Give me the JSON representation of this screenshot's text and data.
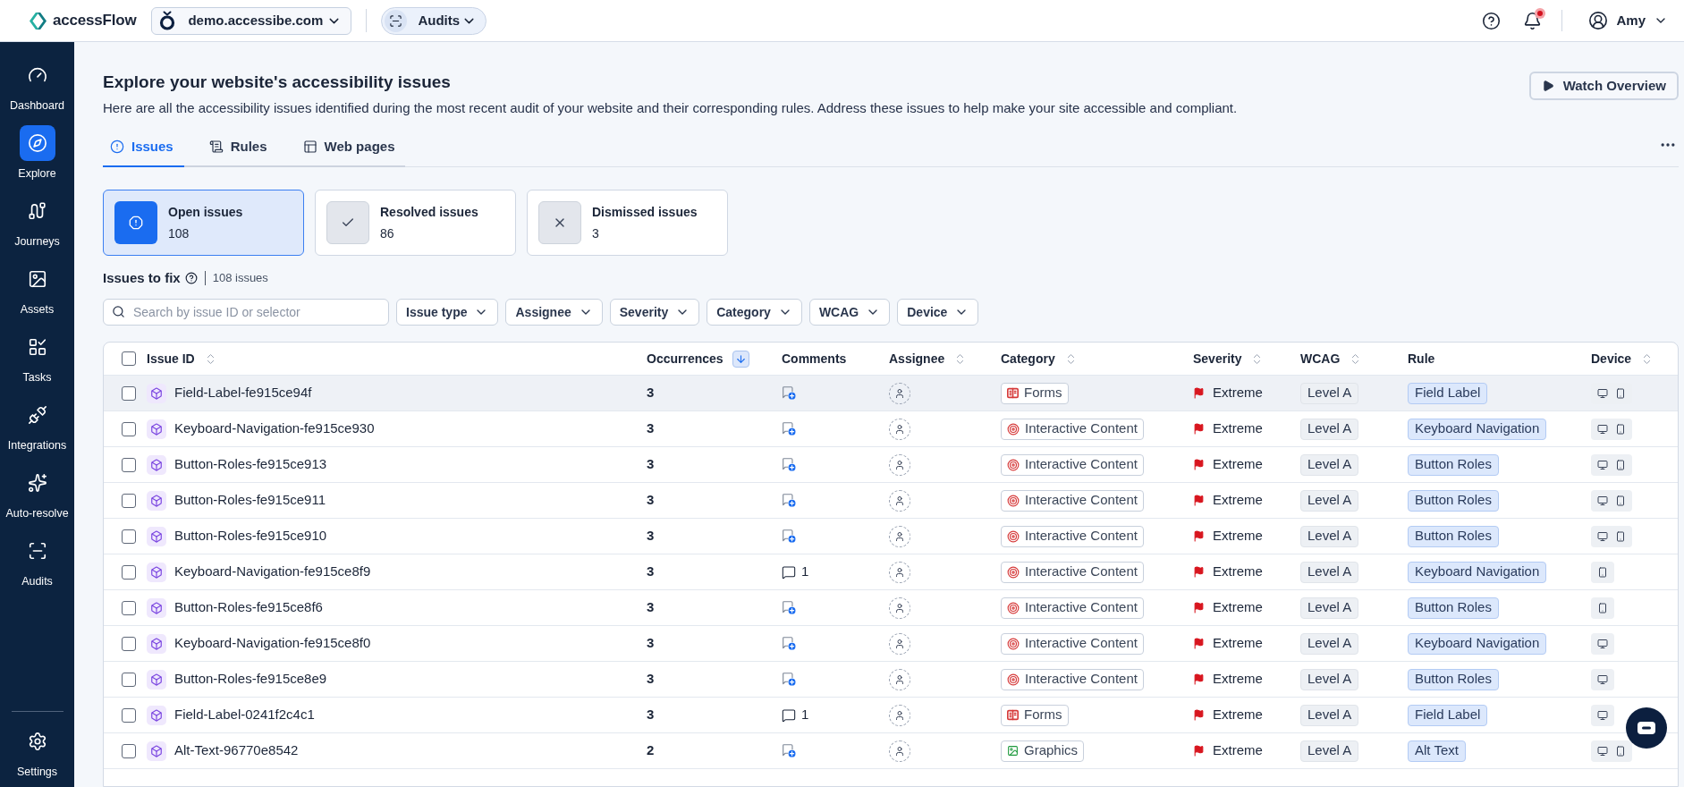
{
  "top_bar": {
    "brand": "accessFlow",
    "site_selector": {
      "value": "demo.accessibe.com"
    },
    "section_selector": {
      "value": "Audits"
    },
    "notifications": {
      "unread": true
    },
    "user": {
      "name": "Amy"
    }
  },
  "sidebar": {
    "items": [
      {
        "label": "Dashboard",
        "selected": false
      },
      {
        "label": "Explore",
        "selected": true
      },
      {
        "label": "Journeys",
        "selected": false
      },
      {
        "label": "Assets",
        "selected": false
      },
      {
        "label": "Tasks",
        "selected": false
      },
      {
        "label": "Integrations",
        "selected": false
      },
      {
        "label": "Auto-resolve",
        "selected": false
      },
      {
        "label": "Audits",
        "selected": false
      }
    ],
    "footer_items": [
      {
        "label": "Settings",
        "selected": false
      }
    ]
  },
  "page": {
    "title": "Explore your website's accessibility issues",
    "description": "Here are all the accessibility issues identified during the most recent audit of your website and their corresponding rules. Address these issues to help make your site accessible and compliant.",
    "watch_button": "Watch Overview"
  },
  "tabs": [
    {
      "label": "Issues",
      "selected": true
    },
    {
      "label": "Rules",
      "selected": false
    },
    {
      "label": "Web pages",
      "selected": false
    }
  ],
  "summary_cards": [
    {
      "title": "Open issues",
      "count": "108",
      "selected": true
    },
    {
      "title": "Resolved issues",
      "count": "86",
      "selected": false
    },
    {
      "title": "Dismissed issues",
      "count": "3",
      "selected": false
    }
  ],
  "issues_header": {
    "title": "Issues to fix",
    "count": "108 issues"
  },
  "search": {
    "placeholder": "Search by issue ID or selector"
  },
  "filters": [
    "Issue type",
    "Assignee",
    "Severity",
    "Category",
    "WCAG",
    "Device"
  ],
  "table": {
    "select_all_checked": false,
    "columns": [
      {
        "label": "Issue ID",
        "kind": "sortable"
      },
      {
        "label": "Occurrences",
        "kind": "sorted"
      },
      {
        "label": "Comments",
        "kind": "plain"
      },
      {
        "label": "Assignee",
        "kind": "sortable"
      },
      {
        "label": "Category",
        "kind": "sortable"
      },
      {
        "label": "Severity",
        "kind": "sortable"
      },
      {
        "label": "WCAG",
        "kind": "sortable"
      },
      {
        "label": "Rule",
        "kind": "plain"
      },
      {
        "label": "Device",
        "kind": "sortable"
      }
    ],
    "rows": [
      {
        "checked": false,
        "highlighted": true,
        "id": "Field-Label-fe915ce94f",
        "occurrences": "3",
        "category": {
          "kind": "forms",
          "label": "Forms"
        },
        "severity": "Extreme",
        "wcag": "Level A",
        "rule": "Field Label",
        "devices": [
          {
            "kind": "desktop"
          },
          {
            "kind": "mobile"
          }
        ]
      },
      {
        "checked": false,
        "highlighted": false,
        "id": "Keyboard-Navigation-fe915ce930",
        "occurrences": "3",
        "category": {
          "kind": "interactive",
          "label": "Interactive Content"
        },
        "severity": "Extreme",
        "wcag": "Level A",
        "rule": "Keyboard Navigation",
        "devices": [
          {
            "kind": "desktop"
          },
          {
            "kind": "mobile"
          }
        ]
      },
      {
        "checked": false,
        "highlighted": false,
        "id": "Button-Roles-fe915ce913",
        "occurrences": "3",
        "category": {
          "kind": "interactive",
          "label": "Interactive Content"
        },
        "severity": "Extreme",
        "wcag": "Level A",
        "rule": "Button Roles",
        "devices": [
          {
            "kind": "desktop"
          },
          {
            "kind": "mobile"
          }
        ]
      },
      {
        "checked": false,
        "highlighted": false,
        "id": "Button-Roles-fe915ce911",
        "occurrences": "3",
        "category": {
          "kind": "interactive",
          "label": "Interactive Content"
        },
        "severity": "Extreme",
        "wcag": "Level A",
        "rule": "Button Roles",
        "devices": [
          {
            "kind": "desktop"
          },
          {
            "kind": "mobile"
          }
        ]
      },
      {
        "checked": false,
        "highlighted": false,
        "id": "Button-Roles-fe915ce910",
        "occurrences": "3",
        "category": {
          "kind": "interactive",
          "label": "Interactive Content"
        },
        "severity": "Extreme",
        "wcag": "Level A",
        "rule": "Button Roles",
        "devices": [
          {
            "kind": "desktop"
          },
          {
            "kind": "mobile"
          }
        ]
      },
      {
        "checked": false,
        "highlighted": false,
        "id": "Keyboard-Navigation-fe915ce8f9",
        "occurrences": "3",
        "comments": "1",
        "category": {
          "kind": "interactive",
          "label": "Interactive Content"
        },
        "severity": "Extreme",
        "wcag": "Level A",
        "rule": "Keyboard Navigation",
        "devices": [
          {
            "kind": "mobile"
          }
        ]
      },
      {
        "checked": false,
        "highlighted": false,
        "id": "Button-Roles-fe915ce8f6",
        "occurrences": "3",
        "category": {
          "kind": "interactive",
          "label": "Interactive Content"
        },
        "severity": "Extreme",
        "wcag": "Level A",
        "rule": "Button Roles",
        "devices": [
          {
            "kind": "mobile"
          }
        ]
      },
      {
        "checked": false,
        "highlighted": false,
        "id": "Keyboard-Navigation-fe915ce8f0",
        "occurrences": "3",
        "category": {
          "kind": "interactive",
          "label": "Interactive Content"
        },
        "severity": "Extreme",
        "wcag": "Level A",
        "rule": "Keyboard Navigation",
        "devices": [
          {
            "kind": "desktop"
          }
        ]
      },
      {
        "checked": false,
        "highlighted": false,
        "id": "Button-Roles-fe915ce8e9",
        "occurrences": "3",
        "category": {
          "kind": "interactive",
          "label": "Interactive Content"
        },
        "severity": "Extreme",
        "wcag": "Level A",
        "rule": "Button Roles",
        "devices": [
          {
            "kind": "desktop"
          }
        ]
      },
      {
        "checked": false,
        "highlighted": false,
        "id": "Field-Label-0241f2c4c1",
        "occurrences": "3",
        "comments": "1",
        "category": {
          "kind": "forms",
          "label": "Forms"
        },
        "severity": "Extreme",
        "wcag": "Level A",
        "rule": "Field Label",
        "devices": [
          {
            "kind": "desktop"
          }
        ]
      },
      {
        "checked": false,
        "highlighted": false,
        "id": "Alt-Text-96770e8542",
        "occurrences": "2",
        "category": {
          "kind": "graphics",
          "label": "Graphics"
        },
        "severity": "Extreme",
        "wcag": "Level A",
        "rule": "Alt Text",
        "devices": [
          {
            "kind": "desktop"
          },
          {
            "kind": "mobile"
          }
        ]
      }
    ]
  }
}
